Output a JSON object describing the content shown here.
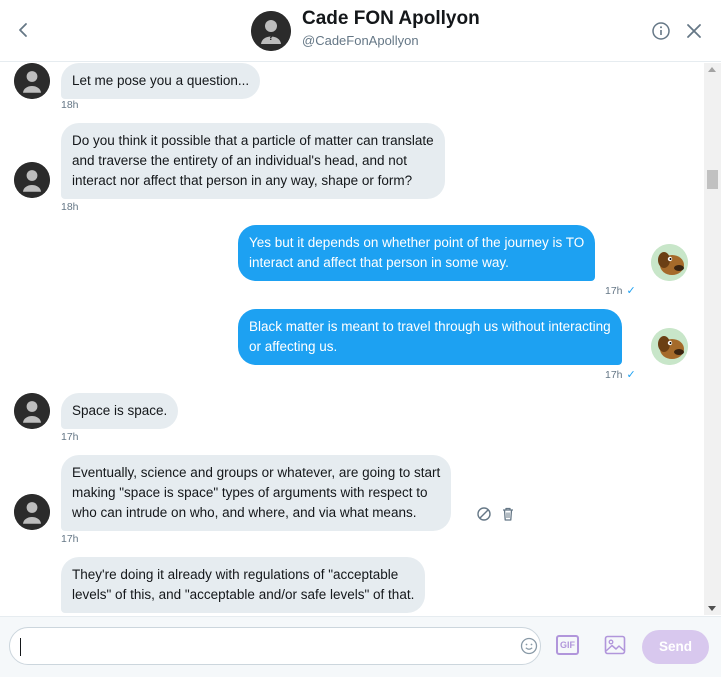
{
  "header": {
    "back_icon": "chevron-left-icon",
    "name": "Cade FON Apollyon",
    "handle": "@CadeFonApollyon",
    "info_icon": "info-icon",
    "close_icon": "close-icon"
  },
  "messages": [
    {
      "direction": "in",
      "lines": [
        "Let me pose you a question..."
      ],
      "time": "18h"
    },
    {
      "direction": "in",
      "lines": [
        "Do you think it possible that a particle of matter can translate",
        "and traverse the entirety of an individual's head, and not",
        "interact nor affect that person in any way, shape or form?"
      ],
      "time": "18h"
    },
    {
      "direction": "out",
      "lines": [
        "Yes but it depends on whether point of the journey is TO",
        "interact and affect that person in some way."
      ],
      "time": "17h",
      "status": "✓"
    },
    {
      "direction": "out",
      "lines": [
        "Black matter is meant to travel through us without interacting",
        "or affecting us."
      ],
      "time": "17h",
      "status": "✓"
    },
    {
      "direction": "in",
      "lines": [
        "Space is space."
      ],
      "time": "17h"
    },
    {
      "direction": "in",
      "lines": [
        "Eventually, science and groups or whatever, are going to start",
        "making \"space is space\" types of arguments with respect to",
        "who can intrude on who, and where, and via what means."
      ],
      "time": "17h"
    },
    {
      "direction": "in",
      "lines": [
        "They're doing it already with regulations of \"acceptable",
        "levels\" of this, and \"acceptable and/or safe levels\" of that."
      ],
      "time": ""
    }
  ],
  "message_actions": {
    "block_icon": "block-icon",
    "delete_icon": "trash-icon"
  },
  "composer": {
    "input_value": "",
    "emoji_icon": "emoji-icon",
    "gif_label": "GIF",
    "image_icon": "image-icon",
    "send_label": "Send"
  },
  "colors": {
    "accent": "#1da1f2",
    "incoming_bubble": "#e6ecf0",
    "send_disabled": "#d8c8ee",
    "icon_purple": "#b196db"
  }
}
